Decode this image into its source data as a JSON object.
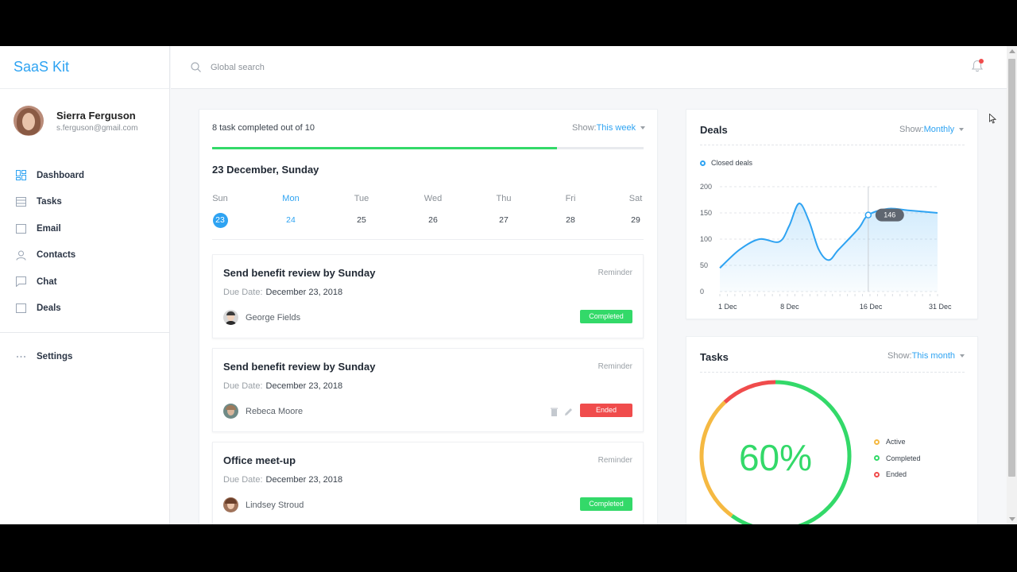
{
  "app": {
    "brand": "SaaS Kit"
  },
  "user": {
    "name": "Sierra Ferguson",
    "email": "s.ferguson@gmail.com"
  },
  "nav": {
    "items": [
      {
        "label": "Dashboard",
        "icon": "dashboard-icon"
      },
      {
        "label": "Tasks",
        "icon": "tasks-icon"
      },
      {
        "label": "Email",
        "icon": "email-icon"
      },
      {
        "label": "Contacts",
        "icon": "contacts-icon"
      },
      {
        "label": "Chat",
        "icon": "chat-icon"
      },
      {
        "label": "Deals",
        "icon": "deals-icon"
      }
    ],
    "settings": {
      "label": "Settings",
      "icon": "more-icon"
    }
  },
  "search": {
    "placeholder": "Global search"
  },
  "tasks_panel": {
    "summary": "8 task completed out of 10",
    "progress": 0.8,
    "show_label": "Show:",
    "show_value": "This week",
    "date_heading": "23 December, Sunday",
    "week": [
      {
        "name": "Sun",
        "num": "23"
      },
      {
        "name": "Mon",
        "num": "24"
      },
      {
        "name": "Tue",
        "num": "25"
      },
      {
        "name": "Wed",
        "num": "26"
      },
      {
        "name": "Thu",
        "num": "27"
      },
      {
        "name": "Fri",
        "num": "28"
      },
      {
        "name": "Sat",
        "num": "29"
      }
    ],
    "list": [
      {
        "title": "Send benefit review by Sunday",
        "type": "Reminder",
        "due_label": "Due Date:",
        "due": "December 23, 2018",
        "person": "George Fields",
        "status": "Completed"
      },
      {
        "title": "Send benefit review by Sunday",
        "type": "Reminder",
        "due_label": "Due Date:",
        "due": "December 23, 2018",
        "person": "Rebeca Moore",
        "status": "Ended"
      },
      {
        "title": "Office meet-up",
        "type": "Reminder",
        "due_label": "Due Date:",
        "due": "December 23, 2018",
        "person": "Lindsey Stroud",
        "status": "Completed"
      }
    ]
  },
  "deals": {
    "title": "Deals",
    "show_label": "Show:",
    "show_value": "Monthly",
    "tooltip": "146"
  },
  "tasks_summary": {
    "title": "Tasks",
    "show_label": "Show:",
    "show_value": "This month",
    "percent_label": "60%",
    "legend": [
      {
        "label": "Active",
        "color": "#f5b942"
      },
      {
        "label": "Completed",
        "color": "#33d969"
      },
      {
        "label": "Ended",
        "color": "#f04c4c"
      }
    ]
  },
  "chart_data": {
    "type": "line",
    "legend": [
      "Closed deals"
    ],
    "y_ticks": [
      "200",
      "150",
      "100",
      "50",
      "0"
    ],
    "x_ticks": [
      "1 Dec",
      "8 Dec",
      "16 Dec",
      "31 Dec"
    ],
    "ylim": [
      0,
      200
    ],
    "series": [
      {
        "name": "Closed deals",
        "points": [
          [
            1,
            45
          ],
          [
            3,
            80
          ],
          [
            5,
            100
          ],
          [
            7,
            95
          ],
          [
            8,
            125
          ],
          [
            9,
            168
          ],
          [
            10,
            135
          ],
          [
            11,
            80
          ],
          [
            12,
            60
          ],
          [
            13,
            80
          ],
          [
            15,
            120
          ],
          [
            16,
            146
          ],
          [
            18,
            158
          ],
          [
            20,
            155
          ],
          [
            23,
            150
          ]
        ]
      }
    ],
    "highlight_value": 146,
    "grid": true,
    "color": "#2ea3f2"
  },
  "donut_data": {
    "type": "pie",
    "segments": [
      {
        "label": "Completed",
        "value": 60,
        "color": "#33d969"
      },
      {
        "label": "Active",
        "value": 28,
        "color": "#f5b942"
      },
      {
        "label": "Ended",
        "value": 12,
        "color": "#f04c4c"
      }
    ]
  }
}
